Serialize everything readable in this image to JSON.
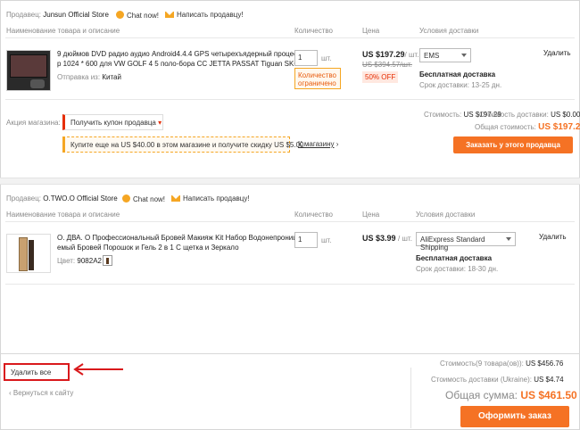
{
  "store1": {
    "seller_label": "Продавец:",
    "seller_name": "Junsun Official Store",
    "chat_label": "Chat now!",
    "message_label": "Написать продавцу!",
    "col_name": "Наименование товара и описание",
    "col_qty": "Количество",
    "col_price": "Цена",
    "col_delivery": "Условия доставки",
    "item": {
      "title_line1": "9 дюймов DVD радио аудио Android4.4.4 GPS четырехъядерный процессо",
      "title_line2": "р 1024 * 600 для VW GOLF 4 5 поло-бора CC JETTA PASSAT Tiguan SKODA",
      "ship_from_label": "Отправка из:",
      "ship_from_value": "Китай",
      "qty_value": "1",
      "qty_unit": "шт.",
      "limited_line1": "Количество",
      "limited_line2": "ограничено",
      "price": "US $197.29",
      "price_unit": "/ шт.",
      "old_price": "US $394.57/шт.",
      "discount": "50% OFF",
      "delivery_method": "EMS",
      "free_shipping": "Бесплатная доставка",
      "delivery_time": "Срок доставки: 13-25 дн.",
      "delete_label": "Удалить"
    },
    "promo_label": "Акция магазина:",
    "coupon_label": "Получить купон продавца",
    "discount_offer": "Купите еще на US $40.00 в этом магазине и получите скидку US $5.00",
    "to_store_label": "К магазину",
    "cost_label": "Стоимость:",
    "cost_value": "US $197.29",
    "shipping_cost_label": "Стоимость доставки:",
    "shipping_cost_value": "US $0.00",
    "total_label": "Общая стоимость:",
    "total_value": "US $197.29",
    "order_button": "Заказать у этого продавца"
  },
  "store2": {
    "seller_label": "Продавец:",
    "seller_name": "O.TWO.O Official Store",
    "chat_label": "Chat now!",
    "message_label": "Написать продавцу!",
    "col_name": "Наименование товара и описание",
    "col_qty": "Количество",
    "col_price": "Цена",
    "col_delivery": "Условия доставки",
    "item": {
      "title_line1": "O. ДВА. O Профессиональный Бровей Макияж Kit Набор Водонепроница",
      "title_line2": "емый Бровей Порошок и Гель 2 в 1 С щетка и Зеркало",
      "color_label": "Цвет:",
      "color_value": "9082A2",
      "qty_value": "1",
      "qty_unit": "шт.",
      "price": "US $3.99",
      "price_unit": "/ шт.",
      "delivery_method": "AliExpress Standard Shipping",
      "free_shipping": "Бесплатная доставка",
      "delivery_time": "Срок доставки: 18-30 дн.",
      "delete_label": "Удалить"
    }
  },
  "footer": {
    "delete_all": "Удалить все",
    "back_link": "Вернуться к сайту",
    "items_cost_label": "Стоимость(9 товара(ов)):",
    "items_cost_value": "US $456.76",
    "shipping_label": "Стоимость доставки (Ukraine):",
    "shipping_value": "US $4.74",
    "grand_total_label": "Общая сумма:",
    "grand_total_value": "US $461.50",
    "checkout_button": "Оформить заказ"
  },
  "colors": {
    "accent": "#f57224",
    "red": "#e62e04",
    "annotation_red": "#d9191c"
  }
}
